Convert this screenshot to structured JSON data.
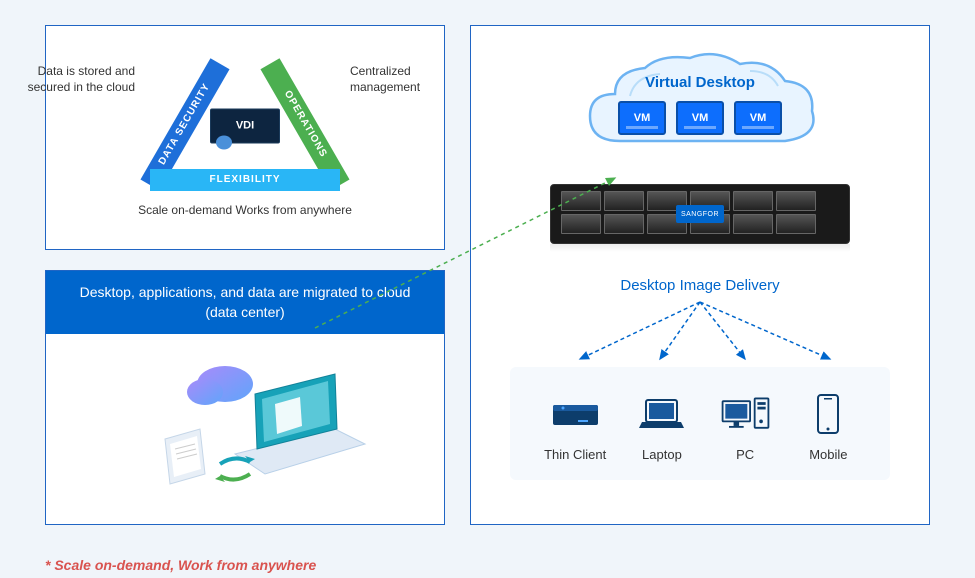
{
  "triangle": {
    "side_left": "DATA SECURITY",
    "side_right": "OPERATIONS",
    "side_bottom": "FLEXIBILITY",
    "center_label": "VDI",
    "label_left": "Data is stored and secured in the cloud",
    "label_right": "Centralized management",
    "label_bottom": "Scale on-demand Works from anywhere"
  },
  "migration": {
    "header": "Desktop, applications, and data are migrated to cloud (data center)"
  },
  "footnote": "* Scale on-demand, Work from anywhere",
  "cloud": {
    "title": "Virtual Desktop",
    "vm_label": "VM"
  },
  "server": {
    "brand": "SANGFOR"
  },
  "delivery": {
    "title": "Desktop Image Delivery"
  },
  "clients": [
    {
      "label": "Thin Client"
    },
    {
      "label": "Laptop"
    },
    {
      "label": "PC"
    },
    {
      "label": "Mobile"
    }
  ]
}
